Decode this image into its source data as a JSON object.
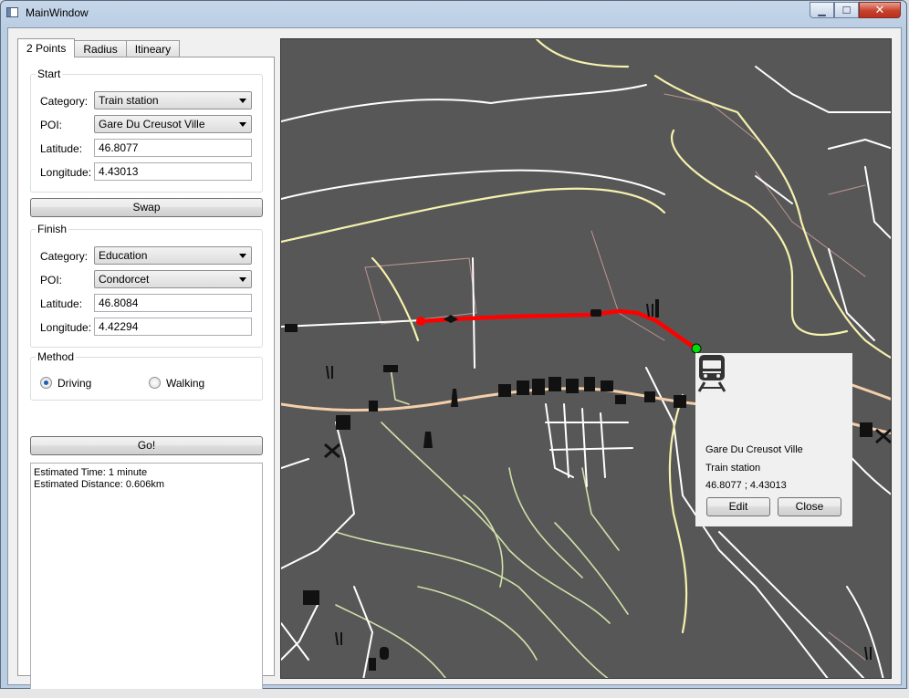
{
  "window": {
    "title": "MainWindow"
  },
  "caption_buttons": {
    "minimize": "▁",
    "maximize": "☐",
    "close": "✕"
  },
  "tabs": [
    {
      "label": "2 Points"
    },
    {
      "label": "Radius"
    },
    {
      "label": "Itineary"
    }
  ],
  "start": {
    "title": "Start",
    "category_label": "Category:",
    "category_value": "Train station",
    "poi_label": "POI:",
    "poi_value": "Gare Du Creusot Ville",
    "latitude_label": "Latitude:",
    "latitude_value": "46.8077",
    "longitude_label": "Longitude:",
    "longitude_value": "4.43013"
  },
  "swap_label": "Swap",
  "finish": {
    "title": "Finish",
    "category_label": "Category:",
    "category_value": "Education",
    "poi_label": "POI:",
    "poi_value": "Condorcet",
    "latitude_label": "Latitude:",
    "latitude_value": "46.8084",
    "longitude_label": "Longitude:",
    "longitude_value": "4.42294"
  },
  "method": {
    "title": "Method",
    "options": [
      {
        "label": "Driving",
        "checked": true
      },
      {
        "label": "Walking",
        "checked": false
      }
    ]
  },
  "go_label": "Go!",
  "output": {
    "line1": "Estimated Time: 1 minute",
    "line2": "Estimated Distance: 0.606km"
  },
  "popup": {
    "name": "Gare Du Creusot Ville",
    "category": "Train station",
    "coords": "46.8077 ; 4.43013",
    "edit_label": "Edit",
    "close_label": "Close"
  },
  "colors": {
    "map_bg": "#575757",
    "road_major": "#f6f1ac",
    "road_minor": "#ffffff",
    "road_secondary": "#cfe0a8",
    "boundary": "#d7a8a0",
    "route": "#ff0000",
    "start_marker": "#00dd00",
    "finish_marker": "#ff0000"
  }
}
